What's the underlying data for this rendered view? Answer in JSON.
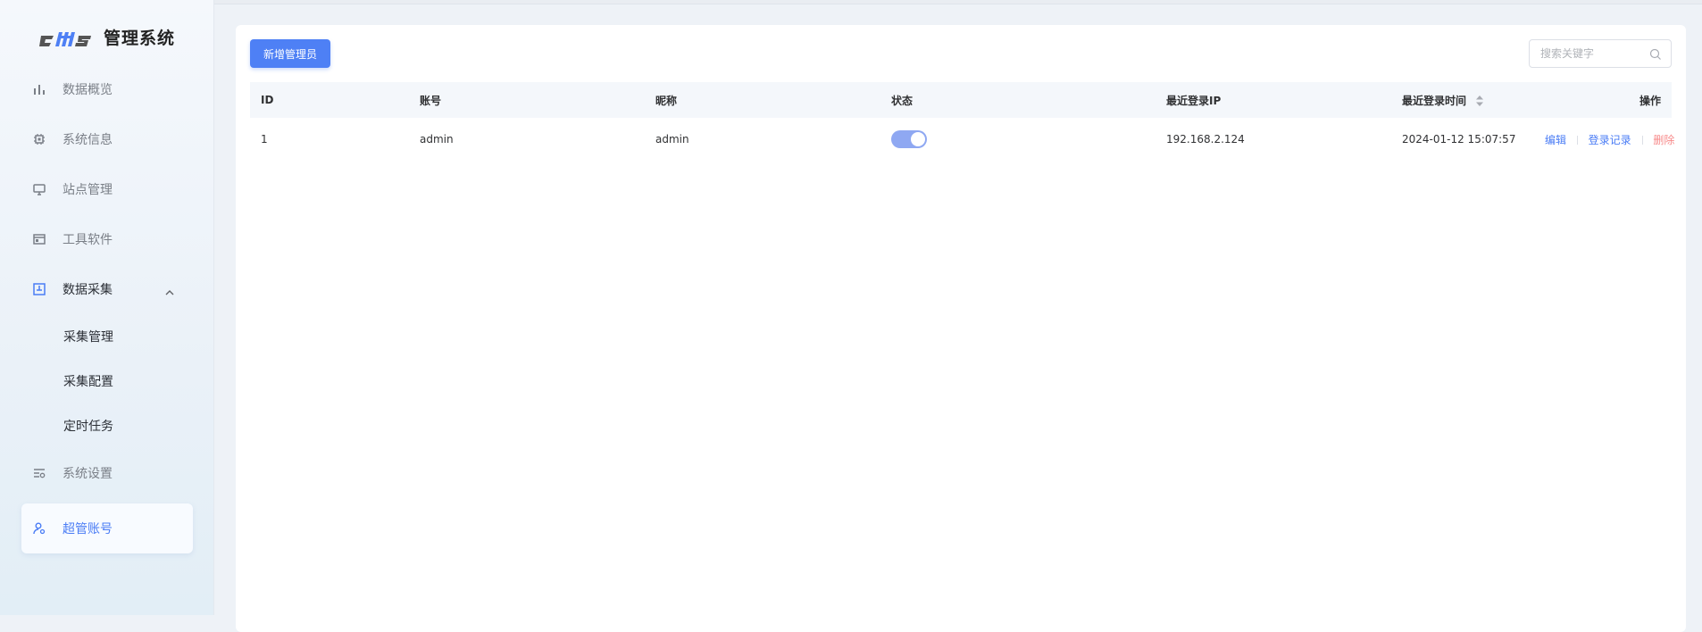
{
  "brand": {
    "logo_text": "cms",
    "title": "管理系统"
  },
  "sidebar": {
    "items": [
      {
        "label": "数据概览",
        "icon": "bar-chart-icon"
      },
      {
        "label": "系统信息",
        "icon": "chip-icon"
      },
      {
        "label": "站点管理",
        "icon": "monitor-icon"
      },
      {
        "label": "工具软件",
        "icon": "window-icon"
      },
      {
        "label": "数据采集",
        "icon": "save-icon",
        "expanded": true,
        "children": [
          {
            "label": "采集管理"
          },
          {
            "label": "采集配置"
          },
          {
            "label": "定时任务"
          }
        ]
      },
      {
        "label": "系统设置",
        "icon": "settings-list-icon"
      },
      {
        "label": "超管账号",
        "icon": "user-gear-icon",
        "active": true
      }
    ]
  },
  "toolbar": {
    "add_label": "新增管理员",
    "search_placeholder": "搜索关键字"
  },
  "table": {
    "columns": [
      "ID",
      "账号",
      "昵称",
      "状态",
      "最近登录IP",
      "最近登录时间",
      "操作"
    ],
    "rows": [
      {
        "id": "1",
        "account": "admin",
        "nickname": "admin",
        "status_on": true,
        "ip": "192.168.2.124",
        "last_login": "2024-01-12 15:07:57",
        "actions": [
          "编辑",
          "登录记录",
          "删除"
        ]
      }
    ]
  },
  "colors": {
    "accent": "#4e80f5",
    "danger": "#f78989",
    "switch_on": "#8fa8f2"
  }
}
